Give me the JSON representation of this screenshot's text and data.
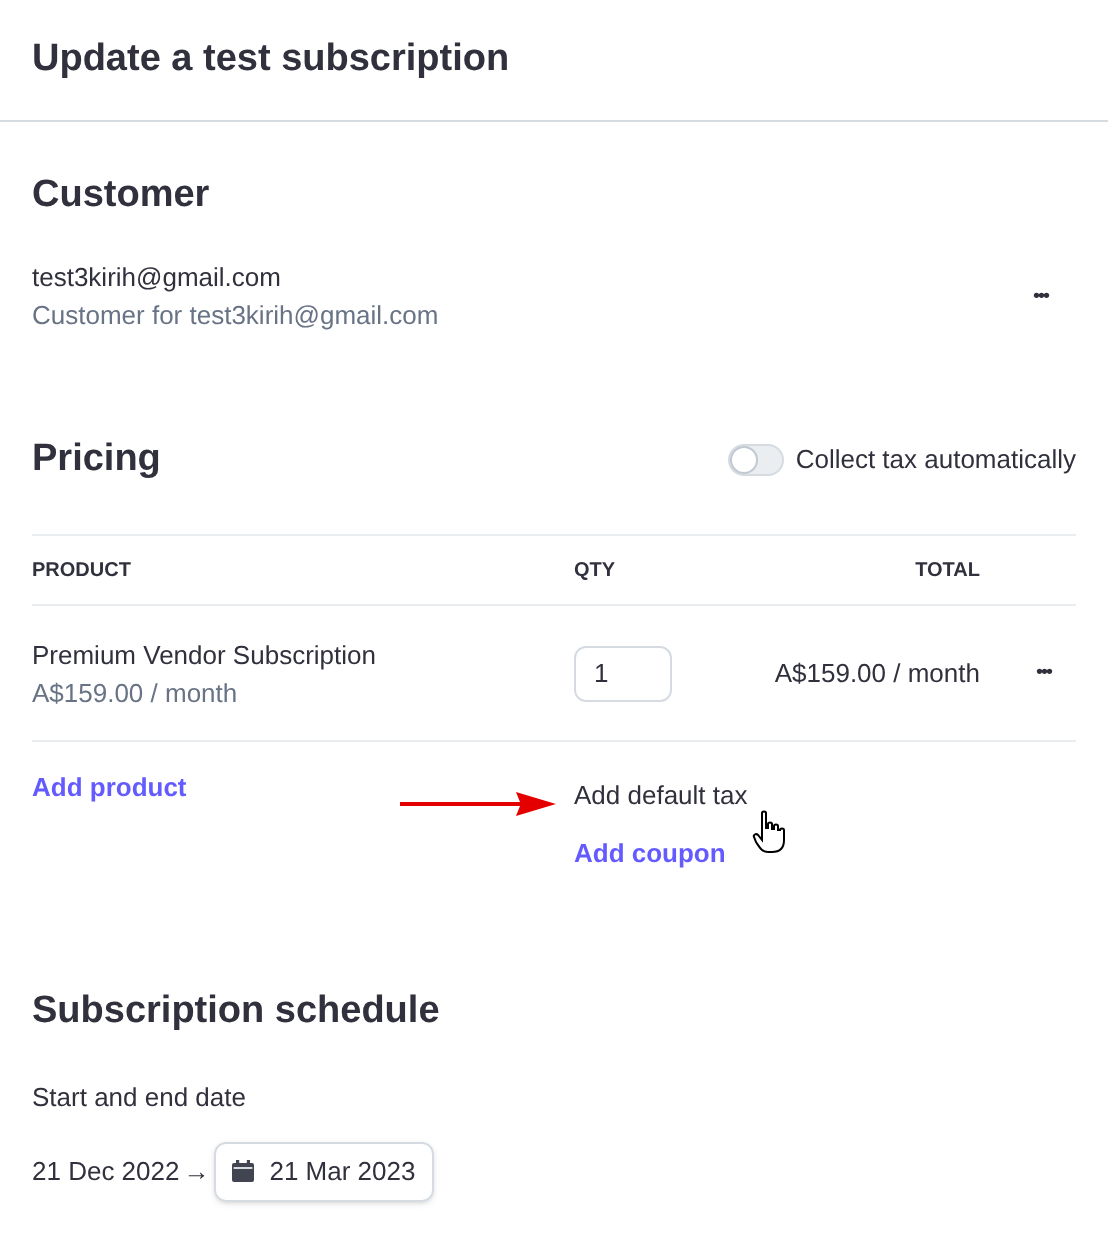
{
  "header": {
    "title": "Update a test subscription"
  },
  "customer": {
    "heading": "Customer",
    "email": "test3kirih@gmail.com",
    "description": "Customer for test3kirih@gmail.com",
    "menu": "•••"
  },
  "pricing": {
    "heading": "Pricing",
    "toggle": {
      "label": "Collect tax automatically",
      "on": false
    },
    "table": {
      "columns": [
        "PRODUCT",
        "QTY",
        "TOTAL"
      ],
      "rows": [
        {
          "product": "Premium Vendor Subscription",
          "price": "A$159.00 / month",
          "qty": "1",
          "total": "A$159.00 / month",
          "menu": "•••"
        }
      ]
    },
    "add_product": "Add product",
    "add_default_tax": "Add default tax",
    "add_coupon": "Add coupon"
  },
  "schedule": {
    "heading": "Subscription schedule",
    "label": "Start and end date",
    "start": "21 Dec 2022",
    "arrow": "→",
    "end": "21 Mar 2023"
  }
}
